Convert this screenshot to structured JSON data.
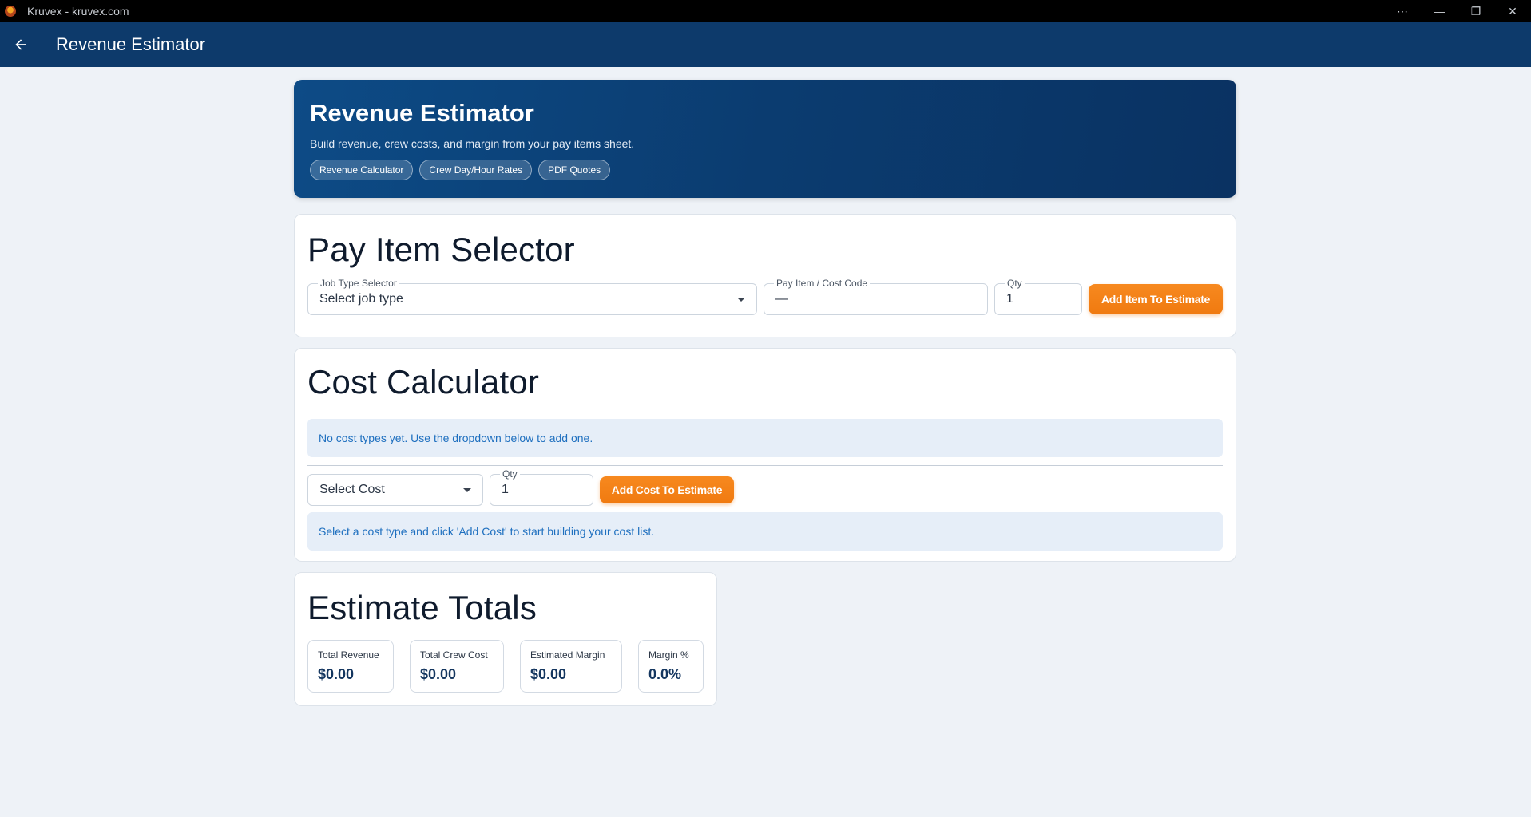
{
  "window": {
    "title": "Kruvex - kruvex.com",
    "controls": [
      "⋯",
      "—",
      "❐",
      "✕"
    ]
  },
  "appbar": {
    "title": "Revenue Estimator"
  },
  "hero": {
    "title": "Revenue Estimator",
    "subtitle": "Build revenue, crew costs, and margin from your pay items sheet.",
    "chips": [
      "Revenue Calculator",
      "Crew Day/Hour Rates",
      "PDF Quotes"
    ]
  },
  "pay_item_selector": {
    "heading": "Pay Item Selector",
    "job_type": {
      "label": "Job Type Selector",
      "value": "Select job type"
    },
    "pay_item": {
      "label": "Pay Item / Cost Code",
      "value": "—"
    },
    "qty": {
      "label": "Qty",
      "value": "1"
    },
    "add_button": "Add Item To Estimate"
  },
  "cost_calculator": {
    "heading": "Cost Calculator",
    "empty_message": "No cost types yet. Use the dropdown below to add one.",
    "cost_select": {
      "value": "Select Cost"
    },
    "qty": {
      "label": "Qty",
      "value": "1"
    },
    "add_button": "Add Cost To Estimate",
    "hint": "Select a cost type and click 'Add Cost' to start building your cost list."
  },
  "estimate_totals": {
    "heading": "Estimate Totals",
    "stats": [
      {
        "label": "Total Revenue",
        "value": "$0.00"
      },
      {
        "label": "Total Crew Cost",
        "value": "$0.00"
      },
      {
        "label": "Estimated Margin",
        "value": "$0.00"
      },
      {
        "label": "Margin %",
        "value": "0.0%"
      }
    ]
  },
  "colors": {
    "appbar": "#0d3a6b",
    "accent": "#f07a10",
    "info_bg": "#e6eef8",
    "info_text": "#1e6fbf"
  }
}
